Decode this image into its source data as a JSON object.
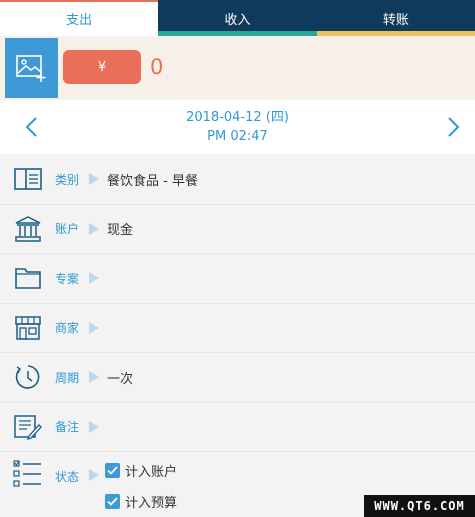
{
  "tabs": [
    {
      "label": "支出"
    },
    {
      "label": "收入"
    },
    {
      "label": "转账"
    }
  ],
  "amount": {
    "currency_symbol": "¥",
    "value": "0"
  },
  "date": {
    "line1": "2018-04-12 (四)",
    "line2": "PM 02:47"
  },
  "fields": {
    "category": {
      "label": "类别",
      "value": "餐饮食品 - 早餐"
    },
    "account": {
      "label": "账户",
      "value": "现金"
    },
    "project": {
      "label": "专案",
      "value": ""
    },
    "merchant": {
      "label": "商家",
      "value": ""
    },
    "period": {
      "label": "周期",
      "value": "一次"
    },
    "note": {
      "label": "备注",
      "value": ""
    },
    "status": {
      "label": "状态",
      "options": [
        {
          "label": "计入账户",
          "checked": true
        },
        {
          "label": "计入预算",
          "checked": true
        }
      ]
    }
  },
  "watermark": "WWW.QT6.COM",
  "colors": {
    "accent": "#2f98d6",
    "expense": "#e96f58",
    "navy": "#103a5c",
    "teal": "#2aa69a",
    "gold": "#f0c15a"
  }
}
